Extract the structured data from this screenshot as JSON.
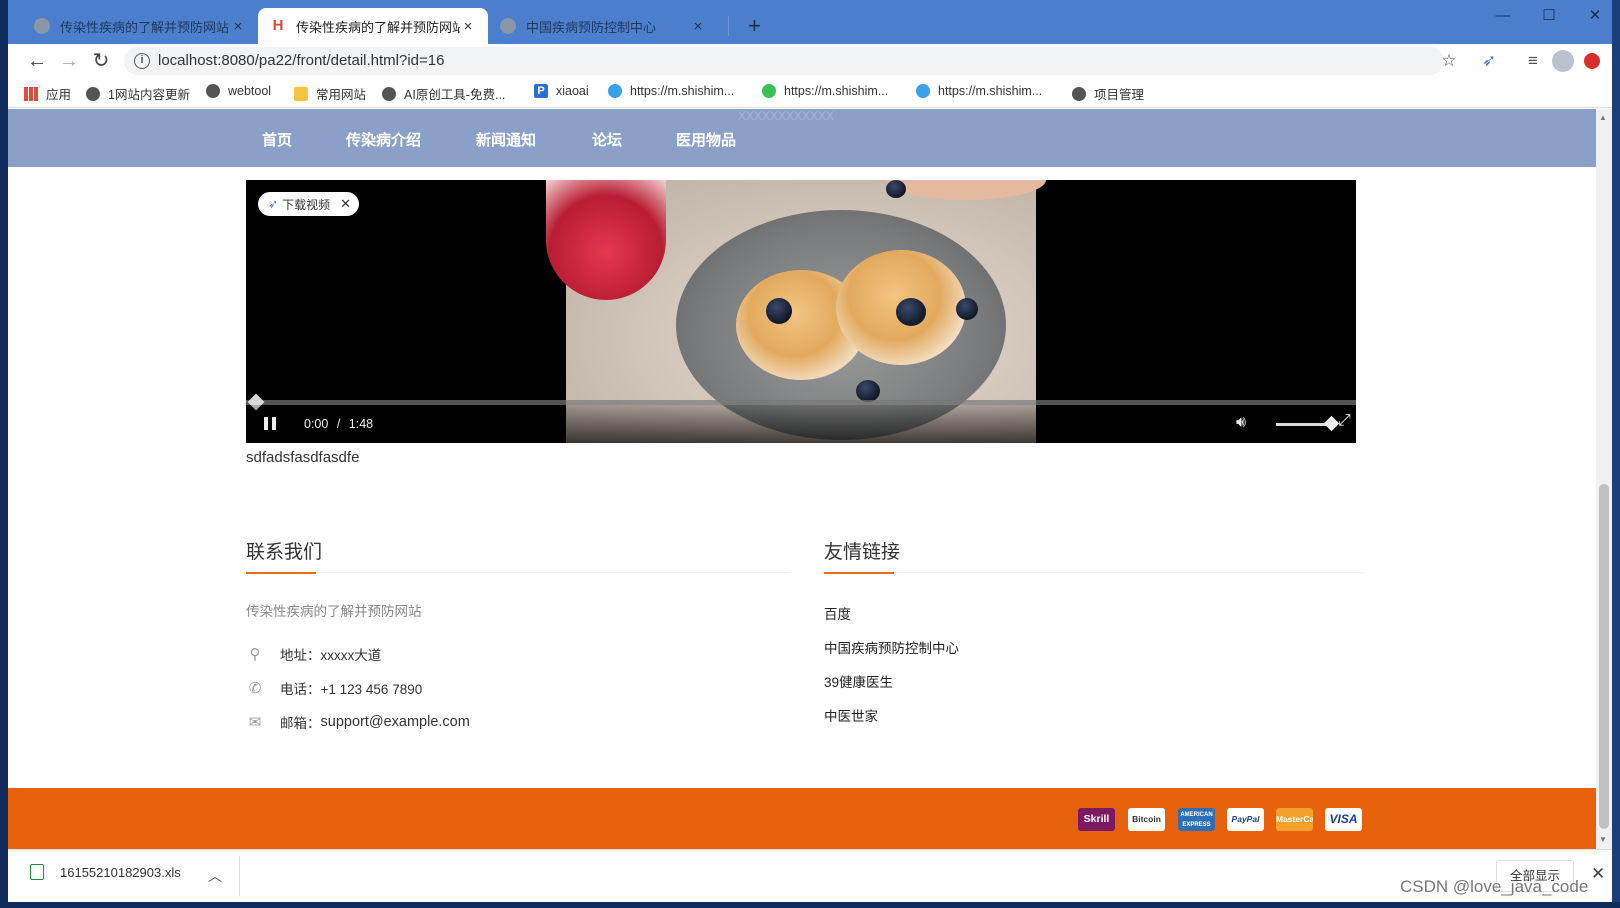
{
  "tabs": [
    {
      "title": "传染性疾病的了解并预防网站",
      "close": "×"
    },
    {
      "title": "传染性疾病的了解并预防网站",
      "close": "×"
    },
    {
      "title": "中国疾病预防控制中心",
      "close": "×"
    }
  ],
  "window_controls": {
    "minimize": "—",
    "maximize": "☐",
    "close": "✕"
  },
  "address": {
    "url": "localhost:8080/pa22/front/detail.html?id=16"
  },
  "bookmarks": [
    "应用",
    "1网站内容更新",
    "webtool",
    "常用网站",
    "AI原创工具-免费...",
    "xiaoai",
    "https://m.shishim...",
    "https://m.shishim...",
    "https://m.shishim...",
    "项目管理"
  ],
  "nav": [
    "首页",
    "传染病介绍",
    "新闻通知",
    "论坛",
    "医用物品"
  ],
  "nav_faint": "XXXXXXXXXXXX",
  "video": {
    "download_badge": "下载视频",
    "current_time": "0:00",
    "separator": "/",
    "duration": "1:48",
    "progress": 0
  },
  "description": "sdfadsfasdfasdfe",
  "contact": {
    "title": "联系我们",
    "site_name": "传染性疾病的了解并预防网站",
    "address": "地址：xxxxx大道",
    "phone": "电话：+1 123 456 7890",
    "email_label": "邮箱：",
    "email": "support@example.com"
  },
  "links": {
    "title": "友情链接",
    "items": [
      "百度",
      "中国疾病预防控制中心",
      "39健康医生",
      "中医世家"
    ]
  },
  "payments": [
    "Skrill",
    "Bitcoin",
    "AMERICAN EXPRESS",
    "PayPal",
    "MasterCard",
    "VISA"
  ],
  "download": {
    "filename": "16155210182903.xls",
    "show_all": "全部显示",
    "close": "✕"
  },
  "watermark": "CSDN @love_java_code",
  "colors": {
    "tabbar": "#4b7fce",
    "navbar": "#8aa0c9",
    "footer": "#e8620e",
    "accent": "#e86d1f"
  }
}
